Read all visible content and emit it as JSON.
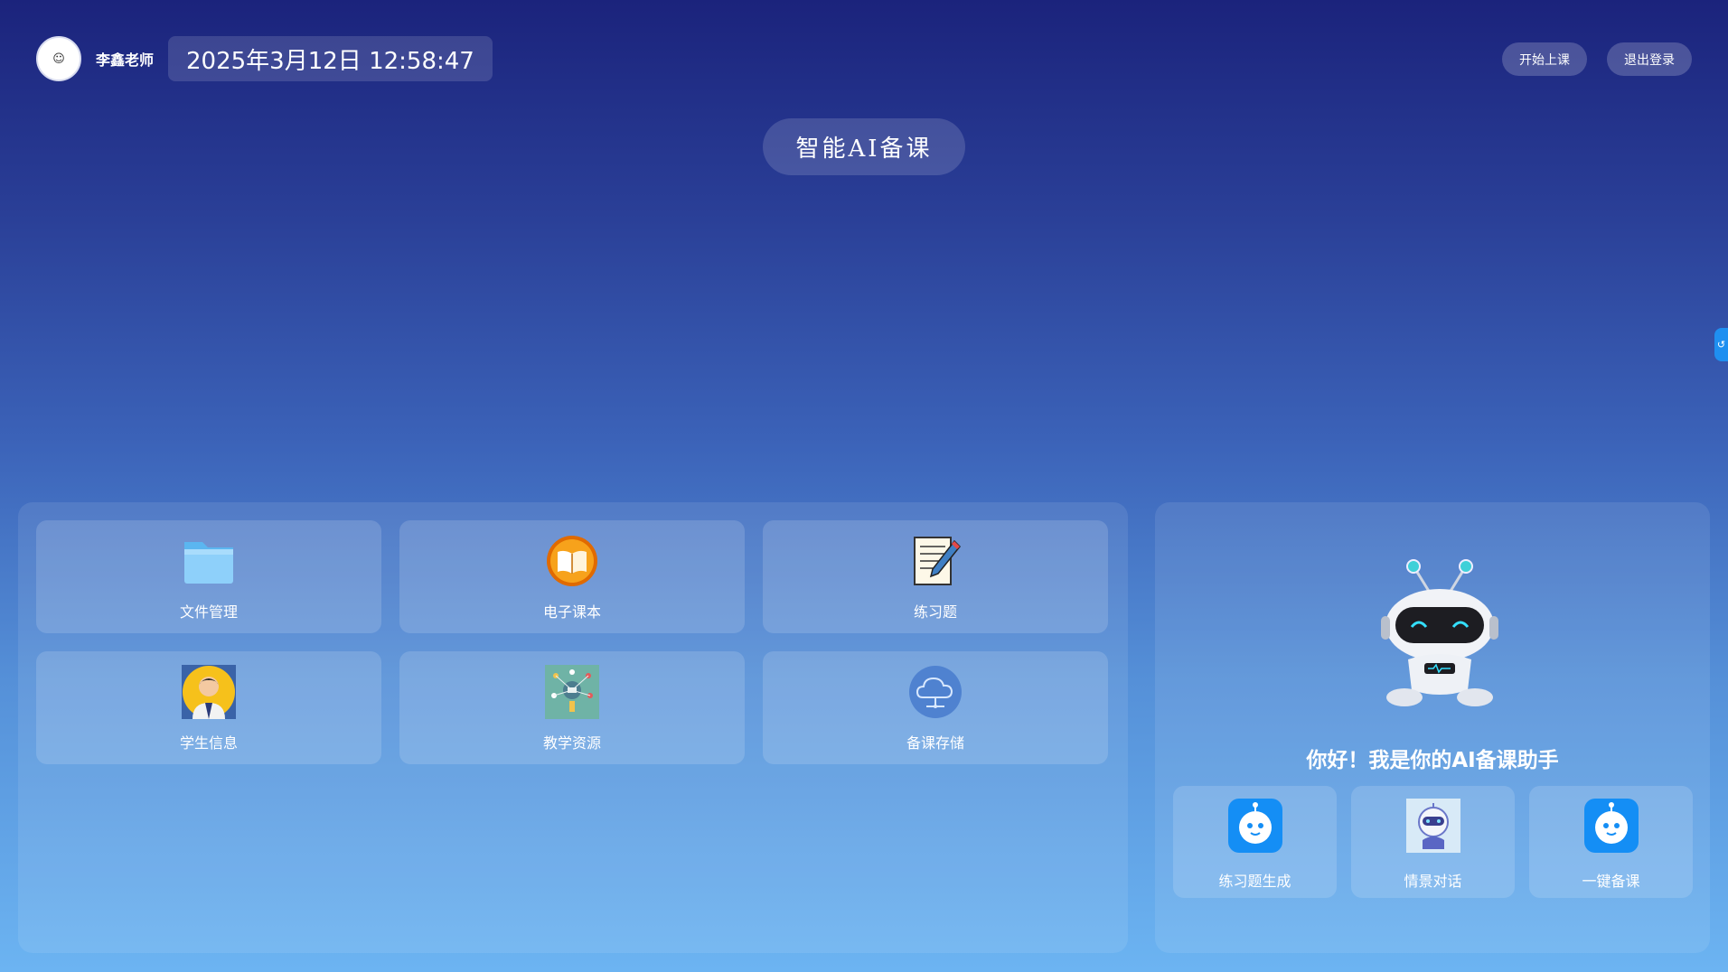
{
  "header": {
    "avatar_glyph": "☺",
    "teacher_name": "李鑫老师",
    "datetime": "2025年3月12日 12:58:47",
    "start_class_label": "开始上课",
    "logout_label": "退出登录"
  },
  "title": "智能AI备课",
  "side_tab_glyph": "↺",
  "tiles": [
    {
      "label": "文件管理",
      "icon": "folder-icon"
    },
    {
      "label": "电子课本",
      "icon": "book-icon"
    },
    {
      "label": "练习题",
      "icon": "notepad-pencil-icon"
    },
    {
      "label": "学生信息",
      "icon": "student-icon"
    },
    {
      "label": "教学资源",
      "icon": "resources-icon"
    },
    {
      "label": "备课存储",
      "icon": "cloud-icon"
    }
  ],
  "assistant": {
    "greeting": "你好！我是你的AI备课助手",
    "actions": [
      {
        "label": "练习题生成",
        "icon": "bot-icon"
      },
      {
        "label": "情景对话",
        "icon": "robot-avatar-icon"
      },
      {
        "label": "一键备课",
        "icon": "bot-icon"
      }
    ]
  },
  "colors": {
    "background_top": "#1b237c",
    "background_bottom": "#6cb4f2",
    "accent": "#1f8ff0"
  }
}
